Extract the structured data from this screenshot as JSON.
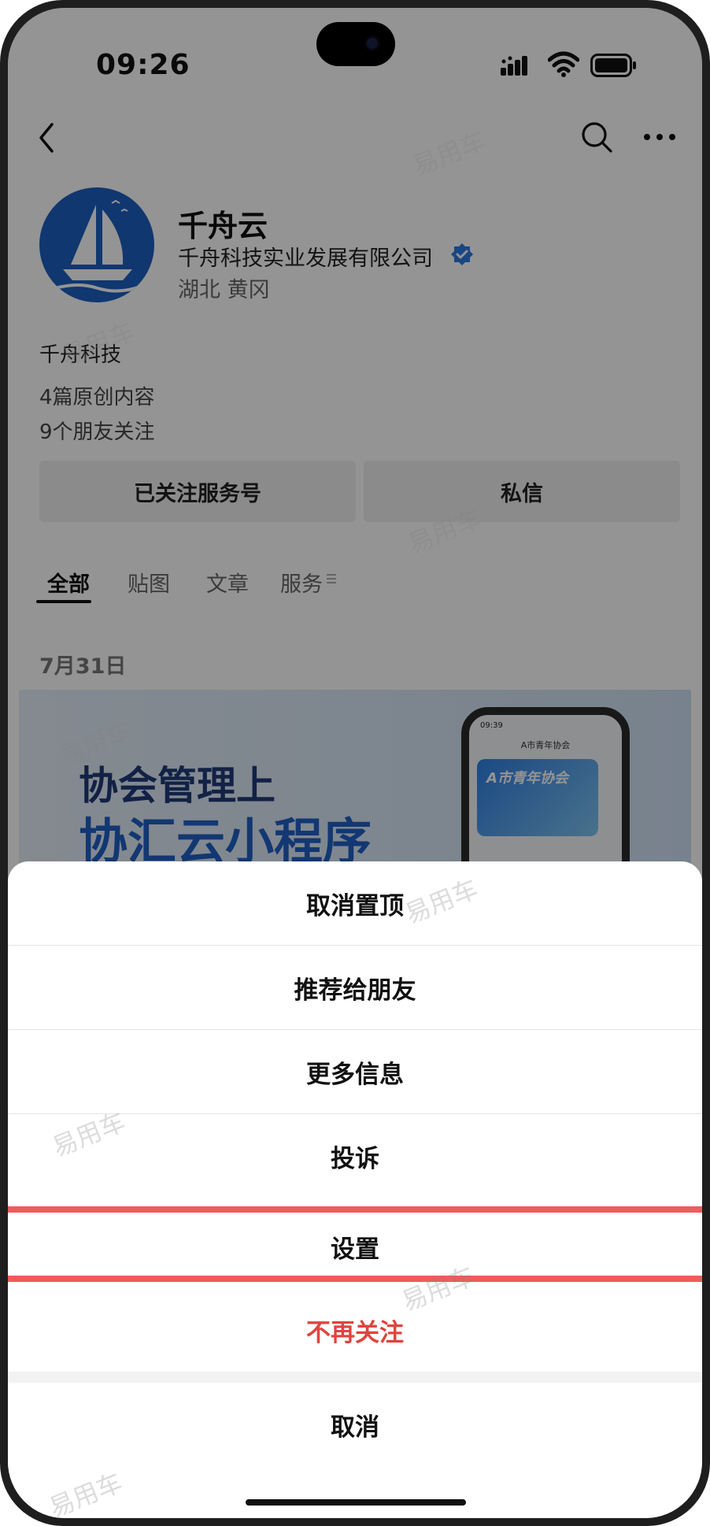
{
  "status_bar": {
    "time": "09:26"
  },
  "nav": {
    "back_icon": "chevron-left-icon",
    "search_icon": "search-icon",
    "more_icon": "more-dots-icon"
  },
  "profile": {
    "name": "千舟云",
    "company": "千舟科技实业发展有限公司",
    "region": "湖北 黄冈",
    "intro": "千舟科技",
    "original_count": "4篇原创内容",
    "friends_following": "9个朋友关注",
    "logo_color": "#1d5fc0"
  },
  "actions": {
    "follow_label": "已关注服务号",
    "message_label": "私信"
  },
  "tabs": [
    {
      "label": "全部",
      "active": true
    },
    {
      "label": "贴图",
      "active": false
    },
    {
      "label": "文章",
      "active": false
    },
    {
      "label": "服务",
      "active": false
    }
  ],
  "feed": {
    "date": "7月31日",
    "banner_line1": "协会管理上",
    "banner_line2": "协汇云小程序",
    "mini_phone_time": "09:39",
    "mini_phone_title": "A市青年协会",
    "mini_card_title": "A市青年协会"
  },
  "watermark": "易用车",
  "sheet": {
    "items": [
      {
        "label": "取消置顶"
      },
      {
        "label": "推荐给朋友"
      },
      {
        "label": "更多信息"
      },
      {
        "label": "投诉"
      },
      {
        "label": "设置"
      },
      {
        "label": "不再关注"
      }
    ],
    "cancel_label": "取消",
    "danger_color": "#e0433e",
    "highlight_color": "#ee5c5c"
  }
}
